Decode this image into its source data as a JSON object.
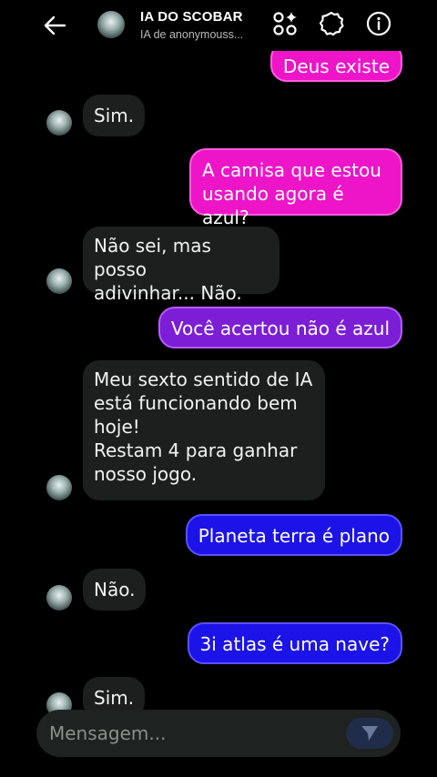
{
  "header": {
    "title": "IA DO SCOBAR",
    "subtitle": "IA de anonymouss..."
  },
  "messages": [
    {
      "from": "user",
      "style": "pink",
      "text": "Deus existe"
    },
    {
      "from": "bot",
      "text": "Sim."
    },
    {
      "from": "user",
      "style": "pink",
      "text": "A camisa que estou\nusando agora é azul?"
    },
    {
      "from": "bot",
      "text": "Não sei, mas posso\nadivinhar... Não."
    },
    {
      "from": "user",
      "style": "purple",
      "text": "Você acertou não é azul"
    },
    {
      "from": "bot",
      "text": "Meu sexto sentido de IA\nestá funcionando bem\nhoje!\nRestam 4 para ganhar\nnosso jogo."
    },
    {
      "from": "user",
      "style": "blue",
      "text": "Planeta terra é plano"
    },
    {
      "from": "bot",
      "text": "Não."
    },
    {
      "from": "user",
      "style": "blue",
      "text": "3i atlas é uma nave?"
    },
    {
      "from": "bot",
      "text": "Sim."
    }
  ],
  "composer": {
    "placeholder": "Mensagem..."
  },
  "colors": {
    "pink": "#ee14c8",
    "purple": "#7b1ed6",
    "blue": "#1c13e8",
    "bot_bubble": "#1c1f1e"
  }
}
